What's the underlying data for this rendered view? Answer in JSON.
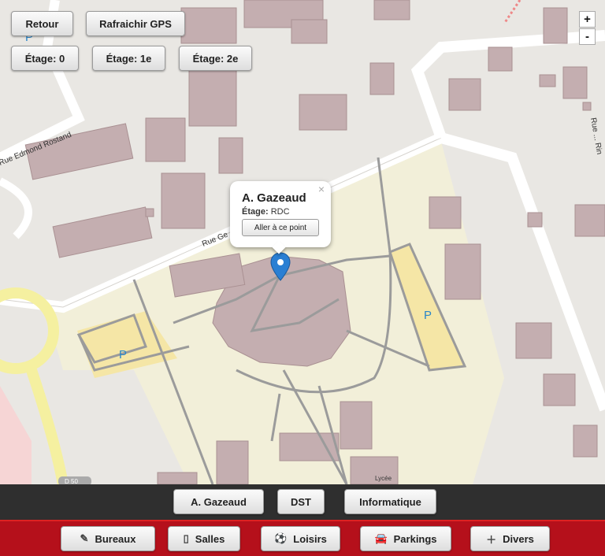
{
  "top_buttons": {
    "back": "Retour",
    "refresh_gps": "Rafraichir GPS"
  },
  "floors": [
    "Étage: 0",
    "Étage: 1e",
    "Étage: 2e"
  ],
  "zoom": {
    "in": "+",
    "out": "-"
  },
  "map_labels": {
    "street_1": "Rue Edmond Rostand",
    "street_2": "Rue Ge",
    "street_3": "Rue ... Rin",
    "parking": "P",
    "lycee": "Lycée",
    "road_ref": "D 50"
  },
  "popup": {
    "title": "A. Gazeaud",
    "floor_label": "Étage:",
    "floor_value": "RDC",
    "button": "Aller à ce point",
    "close": "×"
  },
  "buildings_bar": [
    "A. Gazeaud",
    "DST",
    "Informatique"
  ],
  "categories": [
    {
      "label": "Bureaux",
      "icon": "pencil-icon"
    },
    {
      "label": "Salles",
      "icon": "door-icon"
    },
    {
      "label": "Loisirs",
      "icon": "ball-icon"
    },
    {
      "label": "Parkings",
      "icon": "car-icon"
    },
    {
      "label": "Divers",
      "icon": "plus-icon"
    }
  ],
  "colors": {
    "brand_red": "#b5101b",
    "dark_bar": "#2f2f2f",
    "marker": "#2a7fd3",
    "building": "#c4aeb0",
    "campus": "#f2efd9"
  }
}
